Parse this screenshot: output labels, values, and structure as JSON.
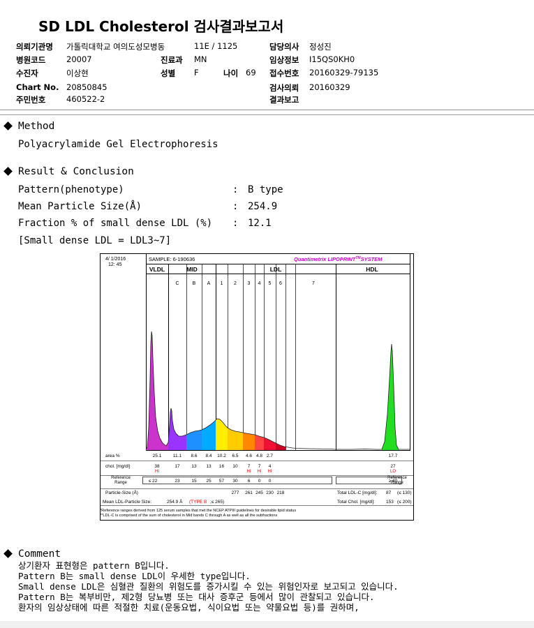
{
  "title": "SD LDL Cholesterol 검사결과보고서",
  "header": {
    "institution_label": "의뢰기관명",
    "institution_value": "가톨릭대학교 여의도성모병동",
    "ward_value": "11E / 1125",
    "doctor_label": "담당의사",
    "doctor_value": "정성진",
    "hospital_code_label": "병원코드",
    "hospital_code_value": "20007",
    "dept_label": "진료과",
    "dept_value": "MN",
    "clinical_label": "임상정보",
    "clinical_value": "I15QS0KH0",
    "patient_label": "수진자",
    "patient_value": "이상현",
    "sex_label": "성별",
    "sex_value": "F",
    "age_label": "나이",
    "age_value": "69",
    "receipt_label": "접수번호",
    "receipt_value": "20160329-79135",
    "chart_label": "Chart No.",
    "chart_value": "20850845",
    "request_label": "검사의뢰",
    "request_value": "20160329",
    "rrn_label": "주민번호",
    "rrn_value": "460522-2",
    "report_label": "결과보고",
    "report_value": ""
  },
  "method": {
    "heading": "Method",
    "text": "Polyacrylamide Gel Electrophoresis"
  },
  "result": {
    "heading": "Result & Conclusion",
    "rows": [
      {
        "label": "Pattern(phenotype)",
        "sep": ":",
        "value": "B type"
      },
      {
        "label": "Mean Particle Size(Å)",
        "sep": ":",
        "value": "254.9"
      },
      {
        "label": "Fraction % of small dense LDL (%)",
        "sep": ":",
        "value": "12.1"
      }
    ],
    "note": "[Small dense LDL = LDL3~7]"
  },
  "chart_data": {
    "type": "area",
    "date": "4/ 1/2016",
    "time": "12: 45",
    "sample": "SAMPLE:  6-190636",
    "brand": "Quantimetrix LIPOPRINT",
    "brand_tm": "TM",
    "brand_suffix": "SYSTEM",
    "groups": [
      "VLDL",
      "MID",
      "LDL",
      "HDL"
    ],
    "bands": [
      "C",
      "B",
      "A",
      "1",
      "2",
      "3",
      "4",
      "5",
      "6",
      "7"
    ],
    "area_label": "area %",
    "area_values": [
      "25.1",
      "11.1",
      "8.6",
      "8.4",
      "10.2",
      "6.5",
      "4.6",
      "4.8",
      "2.7",
      "17.7"
    ],
    "chol_label": "chol. [mg/dl]",
    "chol_values": [
      "38",
      "17",
      "13",
      "13",
      "16",
      "10",
      "7",
      "7",
      "4",
      "27"
    ],
    "flags": [
      "HI",
      "",
      "",
      "",
      "",
      "",
      "HI",
      "HI",
      "HI",
      "LO"
    ],
    "ref_label_1": "Reference",
    "ref_label_2": "Range",
    "ref_values": [
      "≤ 22",
      "23",
      "15",
      "25",
      "57",
      "30",
      "6",
      "0",
      "0",
      "≥ 40"
    ],
    "particle_label": "Particle-Size (Å)",
    "particle_values": [
      "277",
      "261",
      "245",
      "230",
      "218"
    ],
    "mean_label": "Mean LDL-Particle Size:",
    "mean_value": "254.9 Å",
    "mean_type": "(TYPE B",
    "mean_ref": ";≤ 265)",
    "total_ldl_label": "Total LDL-C [mg/dl]:",
    "total_ldl_value": "87",
    "total_ldl_ref": "(≤ 130)",
    "total_chol_label": "Total Chol. [mg/dl]:",
    "total_chol_value": "153",
    "total_chol_ref": "(≤ 200)",
    "footnote_1": "*Reference ranges derived from 125 serum samples that met the NCEP ATPIII guidelines for desirable lipid status",
    "footnote_2": "**LDL-C is comprised of the sum of cholesterol in Mid bands C through A as well as all the subfractions"
  },
  "comment": {
    "heading": "Comment",
    "lines": [
      "상기환자 표현형은 pattern B입니다.",
      "Pattern B는 small dense LDL이 우세한 type입니다.",
      "Small dense LDL은 심혈관 질환의 위험도를 증가시킬 수 있는 위험인자로 보고되고 있습니다.",
      "Pattern B는 복부비만, 제2형 당뇨병 또는 대사 증후군 등에서 많이 관찰되고 있습니다.",
      "환자의 임상상태에 따른 적절한 치료(운동요법, 식이요법 또는 약물요법 등)를 권하며,"
    ]
  },
  "colors": {
    "vldl": "#cc33cc",
    "mid_c": "#9933ff",
    "mid_b": "#1e90ff",
    "mid_a": "#00aaff",
    "ldl1": "#ffee00",
    "ldl2": "#ffcc00",
    "ldl3": "#ff8800",
    "ldl4": "#ff4444",
    "ldl5": "#ee1133",
    "ldl6": "#cc0022",
    "hdl": "#22dd22",
    "brand": "#cc00cc",
    "flag": "#ff0000"
  }
}
